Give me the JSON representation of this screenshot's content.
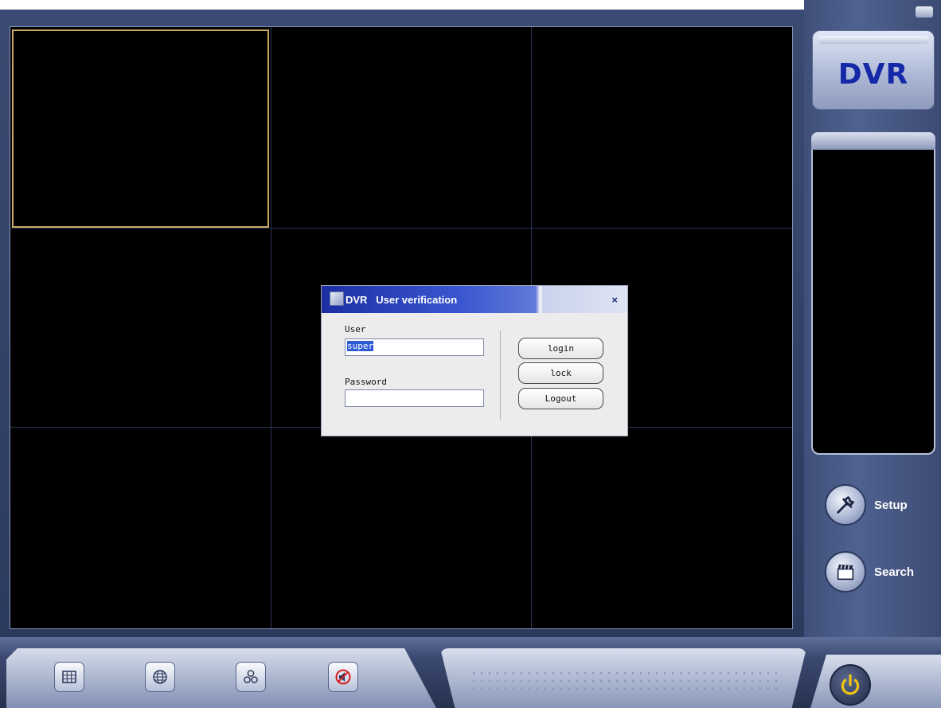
{
  "app": {
    "logo_text": "DVR"
  },
  "side_menu": {
    "setup_label": "Setup",
    "search_label": "Search"
  },
  "video_grid": {
    "rows": 3,
    "cols": 3,
    "selected_cell": 1
  },
  "toolbar": {
    "icons": [
      "grid-layout-icon",
      "globe-icon",
      "three-circles-icon",
      "mute-speaker-icon"
    ],
    "power_icon": "power-icon"
  },
  "dialog": {
    "title": "DVR   User verification",
    "close": "×",
    "user_label": "User",
    "user_value": "super",
    "password_label": "Password",
    "password_value": "",
    "buttons": {
      "login": "login",
      "lock": "lock",
      "logout": "Logout"
    }
  },
  "colors": {
    "selection_border": "#c8a865",
    "logo_text": "#1428a8",
    "title_bar": "#1b2fa3"
  }
}
